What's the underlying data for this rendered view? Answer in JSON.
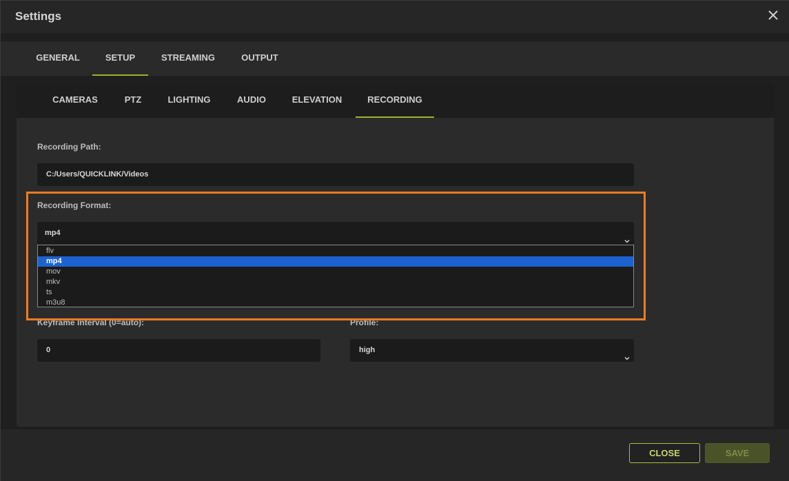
{
  "window": {
    "title": "Settings"
  },
  "main_tabs": [
    {
      "label": "GENERAL"
    },
    {
      "label": "SETUP",
      "active": true
    },
    {
      "label": "STREAMING"
    },
    {
      "label": "OUTPUT"
    }
  ],
  "sub_tabs": [
    {
      "label": "CAMERAS"
    },
    {
      "label": "PTZ"
    },
    {
      "label": "LIGHTING"
    },
    {
      "label": "AUDIO"
    },
    {
      "label": "ELEVATION"
    },
    {
      "label": "RECORDING",
      "active": true
    }
  ],
  "recording": {
    "path_label": "Recording Path:",
    "path_value": "C:/Users/QUICKLINK/Videos",
    "format_label": "Recording Format:",
    "format_value": "mp4",
    "format_options": [
      "flv",
      "mp4",
      "mov",
      "mkv",
      "ts",
      "m3u8"
    ],
    "format_selected": "mp4",
    "keyframe_label": "Keyframe Interval (0=auto):",
    "keyframe_value": "0",
    "profile_label": "Profile:",
    "profile_value": "high"
  },
  "footer": {
    "close_label": "CLOSE",
    "save_label": "SAVE"
  },
  "colors": {
    "accent": "#9bb52d",
    "highlight": "#f47a20",
    "selection": "#1d63cf"
  },
  "icons": {
    "close": "close-icon",
    "dropdown": "chevron-down-icon"
  }
}
